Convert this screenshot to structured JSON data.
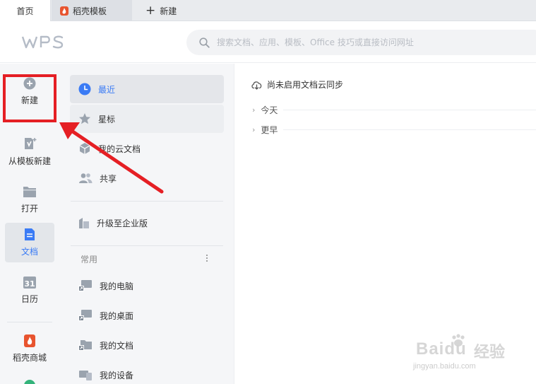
{
  "tabs": [
    {
      "label": "首页"
    },
    {
      "label": "稻壳模板"
    },
    {
      "label": "新建"
    }
  ],
  "header": {
    "logo_text": "WPS",
    "search_placeholder": "搜索文档、应用、模板、Office 技巧或直接访问网址"
  },
  "rail": {
    "items": [
      {
        "label": "新建"
      },
      {
        "label": "从模板新建"
      },
      {
        "label": "打开"
      },
      {
        "label": "文档"
      },
      {
        "label": "日历"
      },
      {
        "label": "稻壳商城"
      }
    ],
    "calendar_day": "31"
  },
  "nav": {
    "items": [
      {
        "label": "最近"
      },
      {
        "label": "星标"
      },
      {
        "label": "我的云文档"
      },
      {
        "label": "共享"
      }
    ],
    "upgrade_label": "升级至企业版",
    "section_label": "常用",
    "common_items": [
      {
        "label": "我的电脑"
      },
      {
        "label": "我的桌面"
      },
      {
        "label": "我的文档"
      },
      {
        "label": "我的设备"
      }
    ]
  },
  "main": {
    "sync_text": "尚未启用文档云同步",
    "groups": [
      {
        "label": "今天"
      },
      {
        "label": "更早"
      }
    ]
  },
  "watermark": {
    "brand": "Baidu",
    "cn": "经验",
    "url": "jingyan.baidu.com"
  },
  "colors": {
    "accent": "#3a7bf5",
    "annotation": "#e51f24",
    "docer": "#e8542f"
  }
}
